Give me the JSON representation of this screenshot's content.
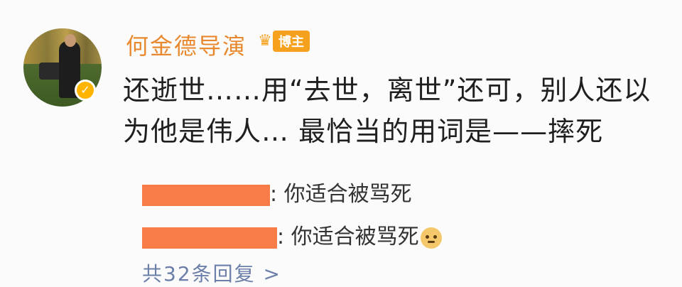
{
  "post": {
    "author": "何金德导演",
    "author_tag": "博主",
    "text": "还逝世……用“去世，离世”还可，别人还以为他是伟人…  最恰当的用词是——摔死"
  },
  "replies": [
    {
      "separator": ":",
      "text": "你适合被骂死"
    },
    {
      "separator": ":",
      "text": "你适合被骂死"
    }
  ],
  "more_replies_label": "共32条回复 >",
  "icons": {
    "verified_badge": "verified-v-icon",
    "tag_crown": "crown-icon",
    "reply_emoji": "doge-emoji-icon"
  },
  "colors": {
    "author_name": "#e9892f",
    "tag_bg": "#f6a11e",
    "redaction": "#f87c47",
    "more_link": "#6b7fa8"
  }
}
